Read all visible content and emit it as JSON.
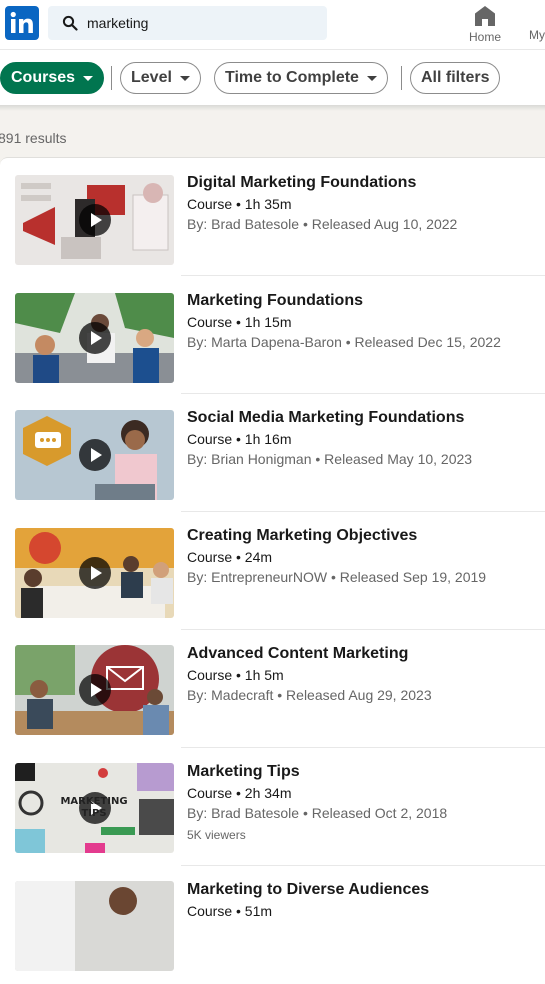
{
  "header": {
    "search_value": "marketing",
    "nav": [
      {
        "label": "Home",
        "icon": "home-icon"
      },
      {
        "label": "My"
      }
    ],
    "brand_color": "#0a66c2"
  },
  "filters": {
    "items": [
      {
        "label": "Courses",
        "active": true
      },
      {
        "label": "Level",
        "active": false
      },
      {
        "label": "Time to Complete",
        "active": false
      },
      {
        "label": "All filters",
        "active": false
      }
    ],
    "active_color": "#01754f"
  },
  "results": {
    "count_text": "891 results",
    "items": [
      {
        "title": "Digital Marketing Foundations",
        "meta": "Course • 1h 35m",
        "byline": "By: Brad Batesole • Released Aug 10, 2022"
      },
      {
        "title": "Marketing Foundations",
        "meta": "Course • 1h 15m",
        "byline": "By: Marta Dapena-Baron • Released Dec 15, 2022"
      },
      {
        "title": "Social Media Marketing Foundations",
        "meta": "Course • 1h 16m",
        "byline": "By: Brian Honigman • Released May 10, 2023"
      },
      {
        "title": "Creating Marketing Objectives",
        "meta": "Course • 24m",
        "byline": "By: EntrepreneurNOW • Released Sep 19, 2019"
      },
      {
        "title": "Advanced Content Marketing",
        "meta": "Course • 1h 5m",
        "byline": "By: Madecraft • Released Aug 29, 2023"
      },
      {
        "title": "Marketing Tips",
        "meta": "Course • 2h 34m",
        "byline": "By: Brad Batesole • Released Oct 2, 2018",
        "viewers": "5K viewers",
        "thumb_text": "MARKETING TIPS"
      },
      {
        "title": "Marketing to Diverse Audiences",
        "meta": "Course • 51m",
        "byline": ""
      }
    ]
  }
}
